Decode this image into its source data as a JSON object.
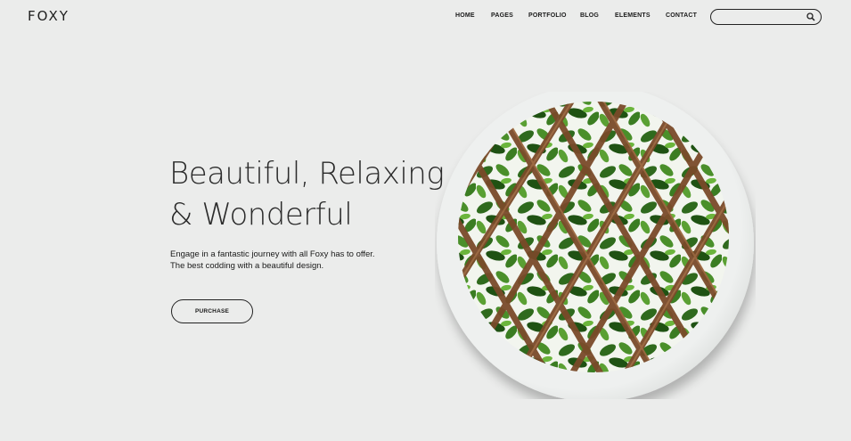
{
  "header": {
    "logo": "FOXY",
    "nav": [
      "HOME",
      "PAGES",
      "PORTFOLIO",
      "BLOG",
      "ELEMENTS",
      "CONTACT"
    ],
    "search": {
      "value": "",
      "placeholder": ""
    }
  },
  "hero": {
    "headline_line1": "Beautiful, Relaxing",
    "headline_line2": "& Wonderful",
    "desc_line1": "Engage in a fantastic journey with all Foxy has to offer.",
    "desc_line2": "The best codding with a beautiful design.",
    "button_label": "PURCHASE"
  },
  "colors": {
    "background": "#ebeceb",
    "leaf": "#2e6b1f",
    "wood": "#7a4a2a"
  }
}
